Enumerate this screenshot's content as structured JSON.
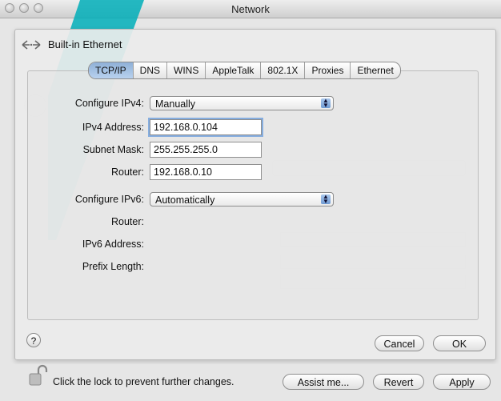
{
  "window": {
    "title": "Network"
  },
  "interface": {
    "name": "Built-in Ethernet"
  },
  "tabs": [
    {
      "label": "TCP/IP",
      "active": true
    },
    {
      "label": "DNS",
      "active": false
    },
    {
      "label": "WINS",
      "active": false
    },
    {
      "label": "AppleTalk",
      "active": false
    },
    {
      "label": "802.1X",
      "active": false
    },
    {
      "label": "Proxies",
      "active": false
    },
    {
      "label": "Ethernet",
      "active": false
    }
  ],
  "tcpip": {
    "configure_ipv4_label": "Configure IPv4:",
    "configure_ipv4_value": "Manually",
    "ipv4_address_label": "IPv4 Address:",
    "ipv4_address_value": "192.168.0.104",
    "subnet_mask_label": "Subnet Mask:",
    "subnet_mask_value": "255.255.255.0",
    "router_label": "Router:",
    "router_value": "192.168.0.10",
    "configure_ipv6_label": "Configure IPv6:",
    "configure_ipv6_value": "Automatically",
    "ipv6_router_label": "Router:",
    "ipv6_address_label": "IPv6 Address:",
    "prefix_length_label": "Prefix Length:"
  },
  "sheet_buttons": {
    "help": "?",
    "cancel": "Cancel",
    "ok": "OK"
  },
  "footer": {
    "lock_text": "Click the lock to prevent further changes.",
    "assist": "Assist me...",
    "revert": "Revert",
    "apply": "Apply"
  },
  "colors": {
    "accent_tab": "#8fb0d7",
    "focus_ring": "#86aee0",
    "watermark": "#00aeb8"
  }
}
